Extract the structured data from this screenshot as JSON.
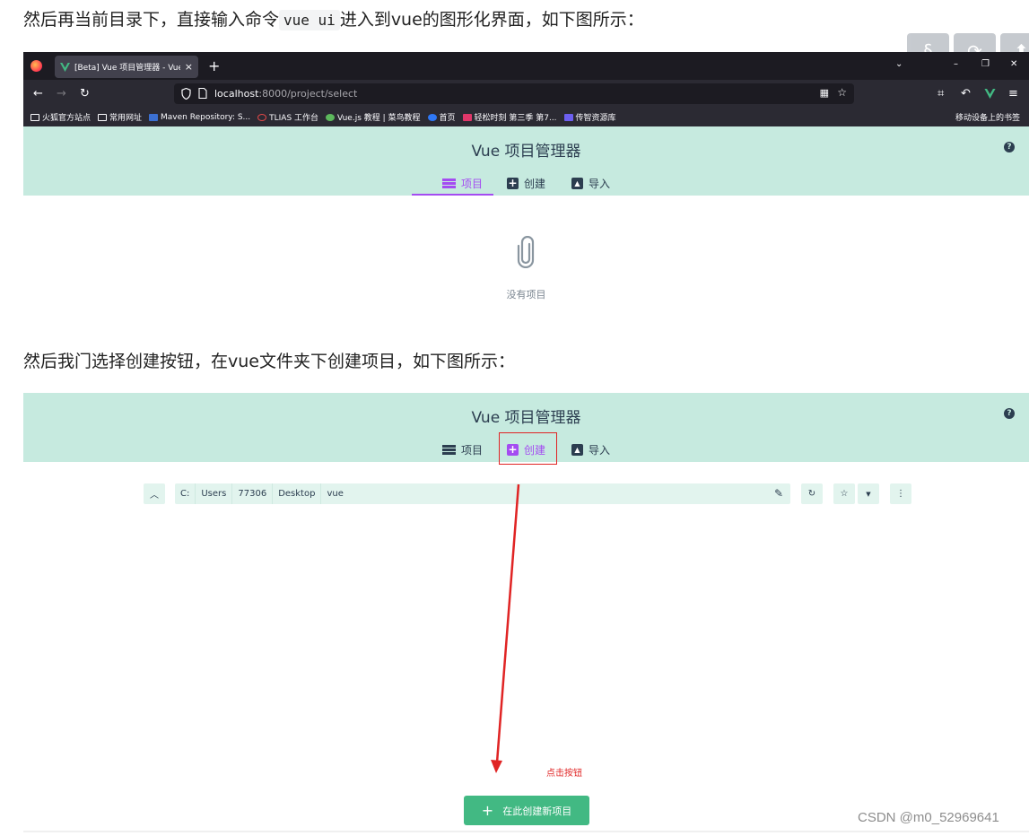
{
  "article": {
    "para1_before": "然后再当前目录下，直接输入命令",
    "para1_code": "vue ui",
    "para1_after": "进入到vue的图形化界面，如下图所示：",
    "para2": "然后我门选择创建按钮，在vue文件夹下创建项目，如下图所示："
  },
  "side_tools": [
    "§",
    "⟳",
    "⬆"
  ],
  "browser": {
    "tab_title": "[Beta] Vue 项目管理器 - Vue C",
    "tab_close": "×",
    "new_tab": "+",
    "window_controls": [
      "⌄",
      "–",
      "❐",
      "✕"
    ],
    "url_host": "localhost",
    "url_rest": ":8000/project/select",
    "bookmarks": [
      "火狐官方站点",
      "常用网址",
      "Maven Repository: S...",
      "TLIAS 工作台",
      "Vue.js 教程 | 菜鸟教程",
      "首页",
      "轻松时刻 第三季 第7...",
      "传智资源库"
    ],
    "bookmarks_right": "移动设备上的书签"
  },
  "vue_ui": {
    "title": "Vue 项目管理器",
    "help": "?",
    "tabs": [
      {
        "label": "项目"
      },
      {
        "label": "创建"
      },
      {
        "label": "导入"
      }
    ],
    "empty_text": "没有项目"
  },
  "create_view": {
    "path": [
      "C:",
      "Users",
      "77306",
      "Desktop",
      "vue"
    ],
    "create_button": "在此创建新项目",
    "annotation": "点击按钮"
  },
  "watermark": "CSDN @m0_52969641",
  "colors": {
    "header_bg": "#c6eadf",
    "accent_purple": "#a44cf1",
    "vue_green": "#42b983",
    "annotation_red": "#e02424"
  }
}
